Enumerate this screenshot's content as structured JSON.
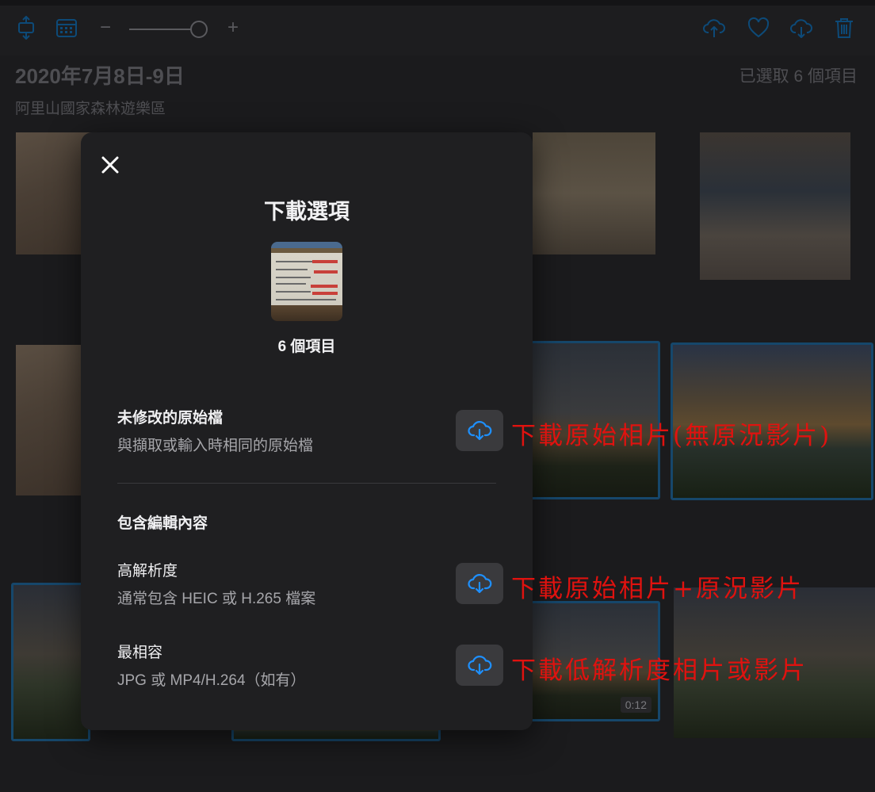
{
  "toolbar": {
    "icons": [
      "expand-vertical-icon",
      "calendar-icon",
      "upload-cloud-icon",
      "heart-icon",
      "download-cloud-icon",
      "trash-icon"
    ],
    "zoom_minus": "−",
    "zoom_plus": "+",
    "accent": "#0a84ff",
    "zoom_level": 0.85
  },
  "album": {
    "title": "2020年7月8日-9日",
    "location": "阿里山國家森林遊樂區",
    "selected_count": "已選取 6 個項目"
  },
  "grid": {
    "video_duration": "0:12"
  },
  "modal": {
    "title": "下載選項",
    "items_count": "6 個項目",
    "options": [
      {
        "title": "未修改的原始檔",
        "desc": "與擷取或輸入時相同的原始檔"
      },
      {
        "title": "高解析度",
        "desc": "通常包含 HEIC 或 H.265 檔案"
      },
      {
        "title": "最相容",
        "desc": "JPG 或 MP4/H.264（如有）"
      }
    ],
    "section_heading": "包含編輯內容"
  },
  "annotations": [
    "下載原始相片(無原況影片)",
    "下載原始相片+原況影片",
    "下載低解析度相片或影片"
  ],
  "colors": {
    "annotation": "#e0120f",
    "download_icon": "#1e90ff",
    "modal_bg": "#1f1f21"
  }
}
